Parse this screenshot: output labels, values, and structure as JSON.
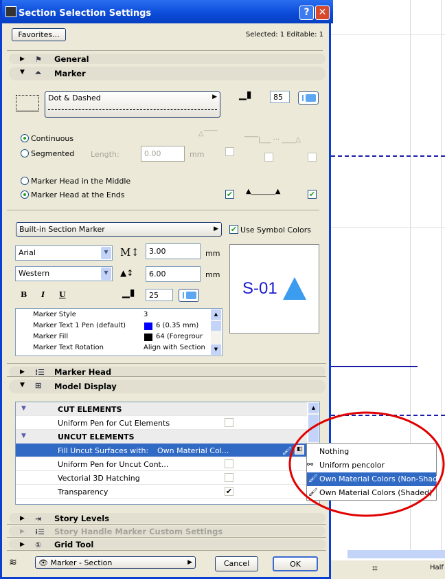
{
  "window": {
    "title": "Section Selection Settings",
    "help": "?",
    "close": "✕"
  },
  "header": {
    "favorites": "Favorites...",
    "selection_info": "Selected: 1 Editable: 1"
  },
  "sections": {
    "general": "General",
    "marker": "Marker",
    "marker_head": "Marker Head",
    "model_display": "Model Display",
    "story_levels": "Story Levels",
    "story_handle": "Story Handle Marker Custom Settings",
    "grid_tool": "Grid Tool"
  },
  "marker": {
    "line_type": "Dot & Dashed",
    "line_pen": "85",
    "continuous": "Continuous",
    "segmented": "Segmented",
    "length_label": "Length:",
    "length_value": "0.00",
    "length_unit": "mm",
    "head_middle": "Marker Head in the Middle",
    "head_ends": "Marker Head at the Ends",
    "selected_segment": "continuous",
    "selected_head": "ends",
    "symbol_type": "Built-in Section Marker",
    "use_symbol_colors": "Use Symbol Colors",
    "use_symbol_colors_checked": true,
    "font": "Arial",
    "script": "Western",
    "text_size": "3.00",
    "text_unit": "mm",
    "marker_size": "6.00",
    "marker_unit": "mm",
    "bold": "B",
    "italic": "I",
    "underline": "U",
    "text_pen": "25",
    "preview_text": "S-01",
    "preview_color": "#1a1ad0",
    "preview_triangle_color": "#3c9cf0",
    "params": [
      {
        "name": "Marker Style",
        "value": "3"
      },
      {
        "name": "Marker Text 1 Pen (default)",
        "value": "6 (0.35 mm)",
        "swatch": "#0000ff"
      },
      {
        "name": "Marker Fill",
        "value": "64 (Foregrour",
        "swatch": "#000000"
      },
      {
        "name": "Marker Text Rotation",
        "value": "Align with Section"
      }
    ]
  },
  "model_display": {
    "cut_header": "CUT ELEMENTS",
    "uniform_pen_cut": "Uniform Pen for Cut Elements",
    "uncut_header": "UNCUT ELEMENTS",
    "fill_uncut": "Fill Uncut Surfaces with:",
    "fill_uncut_value": "Own Material Col...",
    "uniform_pen_uncut": "Uniform Pen for Uncut Cont...",
    "vectorial_hatching": "Vectorial 3D Hatching",
    "transparency": "Transparency",
    "transparency_checked": true
  },
  "fill_menu": {
    "items": [
      "Nothing",
      "Uniform pencolor",
      "Own Material Colors (Non-Shaded)",
      "Own Material Colors (Shaded)"
    ],
    "selected": "Own Material Colors (Non-Shaded)"
  },
  "footer": {
    "layer": "Marker - Section",
    "cancel": "Cancel",
    "ok": "OK"
  },
  "canvas": {
    "status_label": "Half"
  },
  "colors": {
    "title_bar": "#0a4ad8",
    "selection": "#316ac5",
    "annotation_circle": "#e00000"
  }
}
